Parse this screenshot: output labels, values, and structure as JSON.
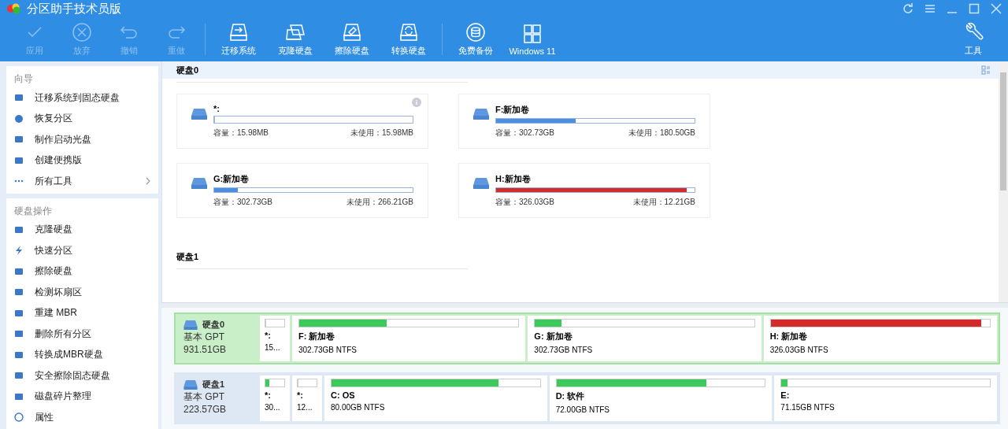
{
  "window": {
    "title": "分区助手技术员版"
  },
  "toolbar": [
    {
      "label": "应用",
      "disabled": true
    },
    {
      "label": "放弃",
      "disabled": true
    },
    {
      "label": "撤销",
      "disabled": true
    },
    {
      "label": "重做",
      "disabled": true
    },
    {
      "label": "迁移系统",
      "disabled": false
    },
    {
      "label": "克隆硬盘",
      "disabled": false
    },
    {
      "label": "擦除硬盘",
      "disabled": false
    },
    {
      "label": "转换硬盘",
      "disabled": false
    },
    {
      "label": "免费备份",
      "disabled": false
    },
    {
      "label": "Windows 11",
      "disabled": false
    }
  ],
  "tools_button": {
    "label": "工具"
  },
  "sidebar": {
    "sections": [
      {
        "title": "向导",
        "items": [
          {
            "label": "迁移系统到固态硬盘",
            "has_submenu": false
          },
          {
            "label": "恢复分区",
            "has_submenu": false
          },
          {
            "label": "制作启动光盘",
            "has_submenu": false
          },
          {
            "label": "创建便携版",
            "has_submenu": false
          },
          {
            "label": "所有工具",
            "has_submenu": true
          }
        ]
      },
      {
        "title": "硬盘操作",
        "items": [
          {
            "label": "克隆硬盘",
            "has_submenu": false
          },
          {
            "label": "快速分区",
            "has_submenu": false
          },
          {
            "label": "擦除硬盘",
            "has_submenu": false
          },
          {
            "label": "检测坏扇区",
            "has_submenu": false
          },
          {
            "label": "重建 MBR",
            "has_submenu": false
          },
          {
            "label": "删除所有分区",
            "has_submenu": false
          },
          {
            "label": "转换成MBR硬盘",
            "has_submenu": false
          },
          {
            "label": "安全擦除固态硬盘",
            "has_submenu": false
          },
          {
            "label": "磁盘碎片整理",
            "has_submenu": false
          },
          {
            "label": "属性",
            "has_submenu": false
          }
        ]
      }
    ]
  },
  "card_view": [
    {
      "title": "硬盘0",
      "partitions": [
        {
          "name": "*:",
          "level": 0,
          "capacity": "容量：15.98MB",
          "free": "未使用：15.98MB",
          "info_icon": true
        },
        {
          "name": "F:新加卷",
          "level": 0.4,
          "color": "#4a8fe0",
          "capacity": "容量：302.73GB",
          "free": "未使用：180.50GB",
          "info_icon": false
        },
        {
          "name": "G:新加卷",
          "level": 0.12,
          "color": "#4a8fe0",
          "capacity": "容量：302.73GB",
          "free": "未使用：266.21GB",
          "info_icon": false
        },
        {
          "name": "H:新加卷",
          "level": 0.96,
          "color": "#d42a2a",
          "capacity": "容量：326.03GB",
          "free": "未使用：12.21GB",
          "info_icon": false
        }
      ]
    },
    {
      "title": "硬盘1"
    }
  ],
  "disks": [
    {
      "name": "硬盘0",
      "type": "基本 GPT",
      "size": "931.51GB",
      "selected": true,
      "partitions": [
        {
          "kind": "small",
          "label": "*:",
          "detail": "15...",
          "level": 0
        },
        {
          "kind": "large",
          "label": "F: 新加卷",
          "detail": "302.73GB NTFS",
          "level": 0.4,
          "color": "#3ccb5a"
        },
        {
          "kind": "large",
          "label": "G: 新加卷",
          "detail": "302.73GB NTFS",
          "level": 0.12,
          "color": "#3ccb5a"
        },
        {
          "kind": "large",
          "label": "H: 新加卷",
          "detail": "326.03GB NTFS",
          "level": 0.96,
          "color": "#d42a2a"
        }
      ]
    },
    {
      "name": "硬盘1",
      "type": "基本 GPT",
      "size": "223.57GB",
      "selected": false,
      "partitions": [
        {
          "kind": "small",
          "label": "*:",
          "detail": "30...",
          "level": 0.2,
          "color": "#3ccb5a"
        },
        {
          "kind": "small",
          "label": "*:",
          "detail": "12...",
          "level": 0
        },
        {
          "kind": "large",
          "label": "C: OS",
          "detail": "80.00GB NTFS",
          "level": 0.8,
          "color": "#3ccb5a"
        },
        {
          "kind": "large",
          "label": "D: 软件",
          "detail": "72.00GB NTFS",
          "level": 0.72,
          "color": "#3ccb5a"
        },
        {
          "kind": "large",
          "label": "E:",
          "detail": "71.15GB NTFS",
          "level": 0.03,
          "color": "#3ccb5a"
        }
      ]
    }
  ]
}
